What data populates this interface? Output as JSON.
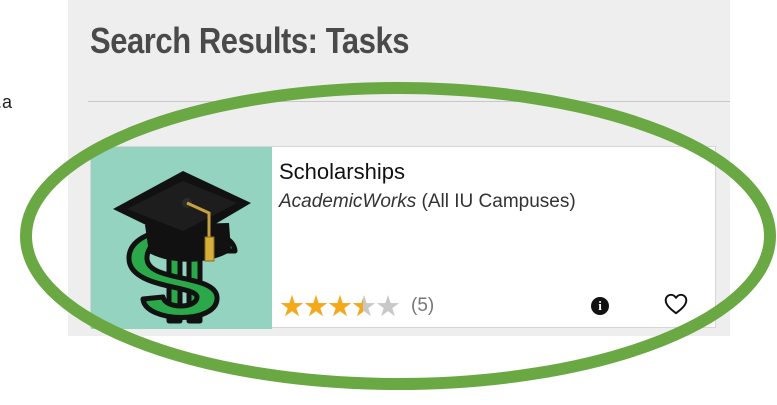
{
  "page": {
    "stray_text": "a."
  },
  "results": {
    "title": "Search Results: Tasks"
  },
  "task_card": {
    "title": "Scholarships",
    "provider": "AcademicWorks",
    "campus": " (All IU Campuses)",
    "rating": 3.5,
    "rating_max": 5,
    "rating_count": "(5)",
    "image_icon": "graduation-cap-dollar-sign",
    "info_icon": "info-circle-icon",
    "favorite_icon": "heart-outline-icon"
  },
  "colors": {
    "thumb_background": "#93d3c0",
    "star_filled": "#f4a81a",
    "star_empty": "#c8c8c8",
    "highlight_ellipse": "#6aa843",
    "panel_background": "#eeeeee",
    "title_text": "#4a4a4a"
  }
}
